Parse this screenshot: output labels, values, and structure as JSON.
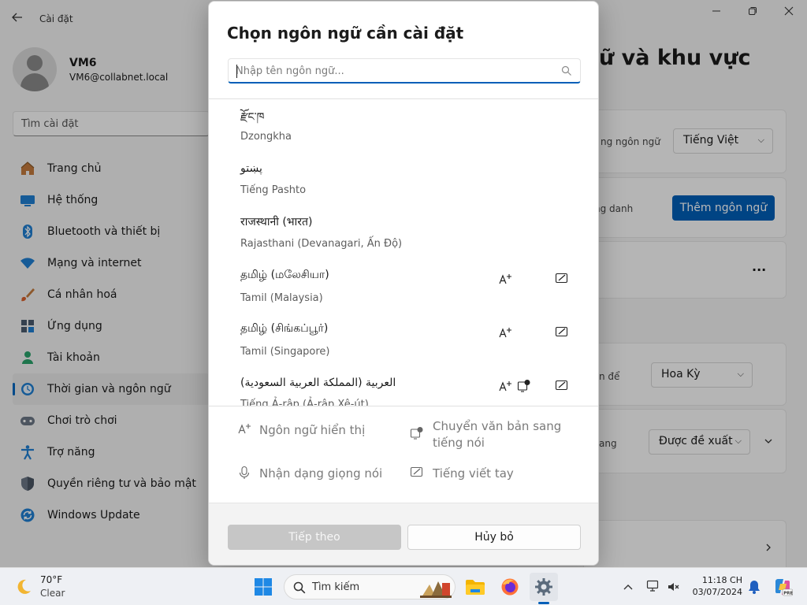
{
  "settings": {
    "app_title": "Cài đặt",
    "user": {
      "name": "VM6",
      "email": "VM6@collabnet.local"
    },
    "search_placeholder": "Tìm cài đặt",
    "nav": [
      {
        "label": "Trang chủ",
        "icon": "home-icon"
      },
      {
        "label": "Hệ thống",
        "icon": "system-icon"
      },
      {
        "label": "Bluetooth và thiết bị",
        "icon": "bluetooth-icon"
      },
      {
        "label": "Mạng và internet",
        "icon": "wifi-icon"
      },
      {
        "label": "Cá nhân hoá",
        "icon": "brush-icon"
      },
      {
        "label": "Ứng dụng",
        "icon": "apps-icon"
      },
      {
        "label": "Tài khoản",
        "icon": "account-icon"
      },
      {
        "label": "Thời gian và ngôn ngữ",
        "icon": "clock-globe-icon",
        "active": true
      },
      {
        "label": "Chơi trò chơi",
        "icon": "gamepad-icon"
      },
      {
        "label": "Trợ năng",
        "icon": "accessibility-icon"
      },
      {
        "label": "Quyền riêng tư và bảo mật",
        "icon": "shield-icon"
      },
      {
        "label": "Windows Update",
        "icon": "update-icon"
      }
    ],
    "page_heading": "ữ và khu vực",
    "display_lang_label": "ng ngôn ngữ",
    "display_lang_value": "Tiếng Việt",
    "preferred_label": "ng danh",
    "add_language_button": "Thêm ngôn ngữ",
    "more_button": "...",
    "country_label": "n để",
    "country_value": "Hoa Kỳ",
    "format_label": "ang",
    "format_value": "Được đề xuất"
  },
  "dialog": {
    "title": "Chọn ngôn ngữ cần cài đặt",
    "search_placeholder": "Nhập tên ngôn ngữ...",
    "languages": [
      {
        "native": "རྫོང་ཁ",
        "english": "Dzongkha",
        "features": []
      },
      {
        "native": "پښتو",
        "english": "Tiếng Pashto",
        "features": []
      },
      {
        "native": "राजस्थानी (भारत)",
        "english": "Rajasthani (Devanagari, Ấn Độ)",
        "features": []
      },
      {
        "native": "தமிழ் (மலேசியா)",
        "english": "Tamil (Malaysia)",
        "features": [
          "display-language-icon",
          "handwriting-icon"
        ]
      },
      {
        "native": "தமிழ் (சிங்கப்பூர்)",
        "english": "Tamil (Singapore)",
        "features": [
          "display-language-icon",
          "handwriting-icon"
        ]
      },
      {
        "native": "العربية (المملكة العربية السعودية)",
        "english": "Tiếng Ả-rập (Ả-rập Xê-út)",
        "features": [
          "display-language-icon",
          "text-to-speech-icon",
          "handwriting-icon"
        ]
      }
    ],
    "legend": {
      "display_language": "Ngôn ngữ hiển thị",
      "text_to_speech": "Chuyển văn bản sang tiếng nói",
      "speech_recognition": "Nhận dạng giọng nói",
      "handwriting": "Tiếng viết tay"
    },
    "next_button": "Tiếp theo",
    "cancel_button": "Hủy bỏ"
  },
  "taskbar": {
    "weather_temp": "70°F",
    "weather_condition": "Clear",
    "search_label": "Tìm kiếm",
    "time": "11:18 CH",
    "date": "03/07/2024"
  },
  "colors": {
    "accent": "#005fb8",
    "background": "#f3f3f3",
    "dialog": "#ffffff"
  }
}
